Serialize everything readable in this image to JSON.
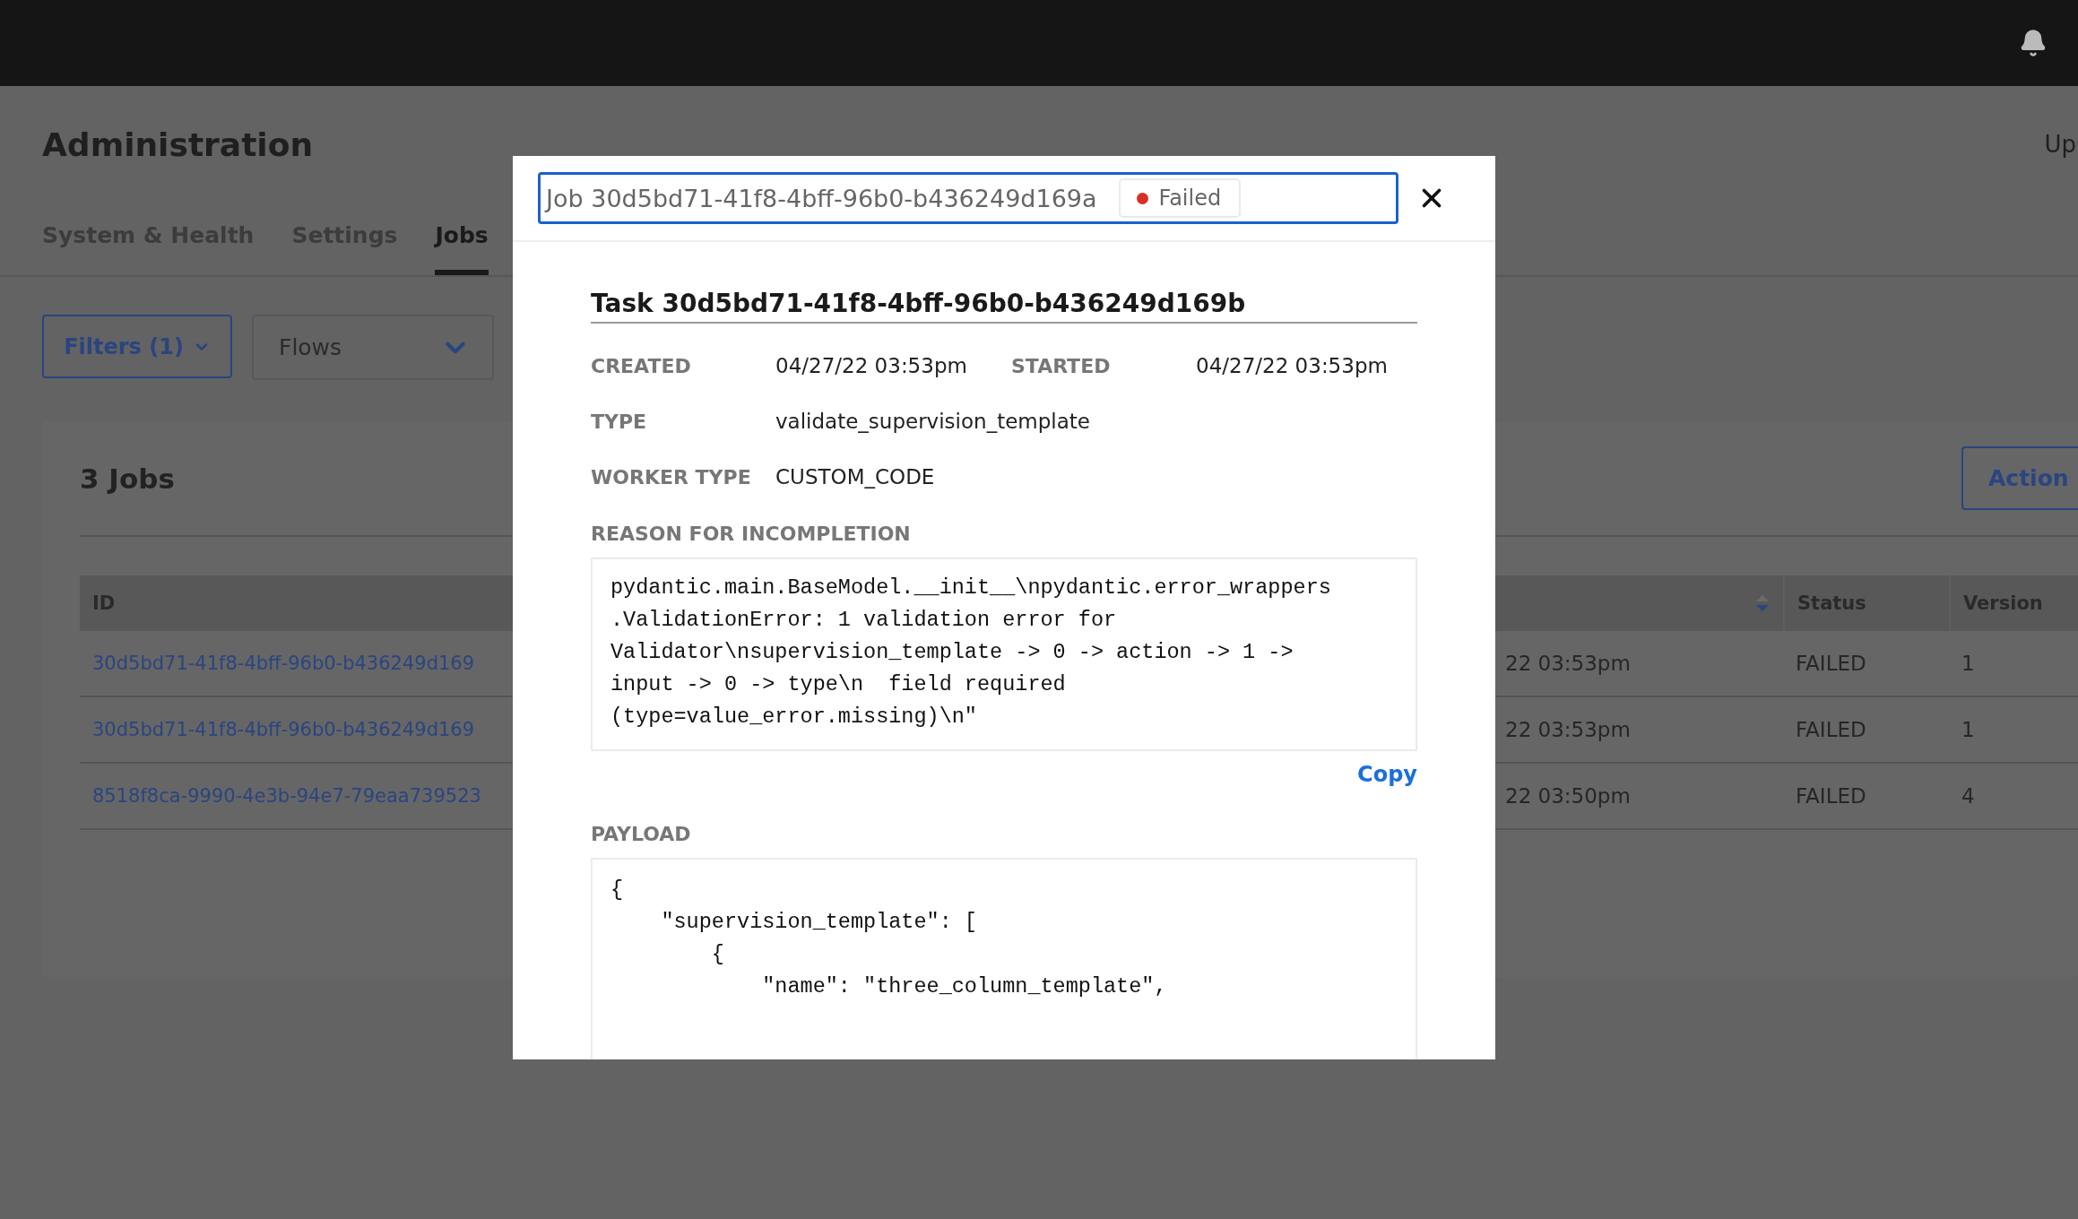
{
  "page": {
    "title": "Administration",
    "corner_text": "Up"
  },
  "tabs": [
    {
      "label": "System & Health",
      "selected": false
    },
    {
      "label": "Settings",
      "selected": false
    },
    {
      "label": "Jobs",
      "selected": true
    }
  ],
  "filters": {
    "filter_button": "Filters (1)",
    "flows_dropdown": "Flows"
  },
  "jobs_panel": {
    "title": "3 Jobs",
    "actions_button": "Action",
    "columns": [
      "ID",
      "Status",
      "Version"
    ],
    "rows": [
      {
        "id": "30d5bd71-41f8-4bff-96b0-b436249d169",
        "column_3": "22 03:53pm",
        "status": "FAILED",
        "version": "1"
      },
      {
        "id": "30d5bd71-41f8-4bff-96b0-b436249d169",
        "column_3": "22 03:53pm",
        "status": "FAILED",
        "version": "1"
      },
      {
        "id": "8518f8ca-9990-4e3b-94e7-79eaa739523",
        "column_3": "22 03:50pm",
        "status": "FAILED",
        "version": "4"
      }
    ]
  },
  "modal": {
    "job_title": "Job 30d5bd71-41f8-4bff-96b0-b436249d169a",
    "status": "Failed",
    "task_title": "Task 30d5bd71-41f8-4bff-96b0-b436249d169b",
    "field_rows": [
      {
        "fields": [
          {
            "label": "CREATED",
            "value": "04/27/22 03:53pm"
          },
          {
            "label": "STARTED",
            "value": "04/27/22 03:53pm"
          }
        ]
      },
      {
        "fields": [
          {
            "label": "TYPE",
            "value": "validate_supervision_template"
          }
        ]
      },
      {
        "fields": [
          {
            "label": "WORKER TYPE",
            "value": "CUSTOM_CODE"
          }
        ]
      }
    ],
    "reason": {
      "label": "REASON FOR INCOMPLETION",
      "lines": [
        "pydantic.main.BaseModel.__init__\\npydantic.error_wrappers",
        ".ValidationError: 1 validation error for",
        "Validator\\nsupervision_template -> 0 -> action -> 1 ->",
        "input -> 0 -> type\\n  field required",
        "(type=value_error.missing)\\n\""
      ],
      "copy_link": "Copy"
    },
    "payload": {
      "label": "PAYLOAD",
      "lines": [
        "{",
        "    \"supervision_template\": [",
        "        {",
        "            \"name\": \"three_column_template\","
      ]
    }
  }
}
